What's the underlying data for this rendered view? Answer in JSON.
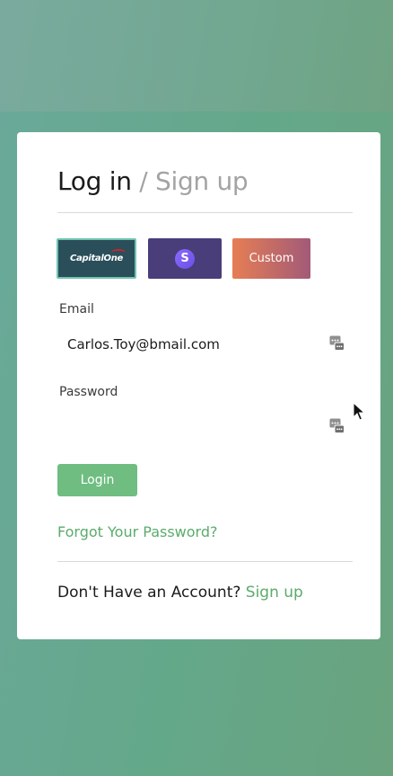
{
  "header": {
    "login_tab": "Log in",
    "separator": "/",
    "signup_tab": "Sign up"
  },
  "providers": {
    "capital_one": {
      "label": "CapitalOne",
      "icon": "capital-one-logo"
    },
    "stripe": {
      "label": "S",
      "icon": "stripe-logo"
    },
    "custom": {
      "label": "Custom"
    }
  },
  "form": {
    "email_label": "Email",
    "email_value": "Carlos.Toy@bmail.com",
    "password_label": "Password",
    "password_value": "",
    "field_icon": "password-manager-icon"
  },
  "actions": {
    "login_label": "Login",
    "forgot_password": "Forgot Your Password?"
  },
  "footer": {
    "prompt": "Don't Have an Account?",
    "signup_link": "Sign up"
  },
  "colors": {
    "accent_green": "#5bab6c",
    "login_button": "#6fbd81",
    "capital_bg": "#2a4e5a",
    "stripe_bg": "#493d7a",
    "custom_gradient_start": "#e67e54",
    "custom_gradient_end": "#a25a78"
  }
}
